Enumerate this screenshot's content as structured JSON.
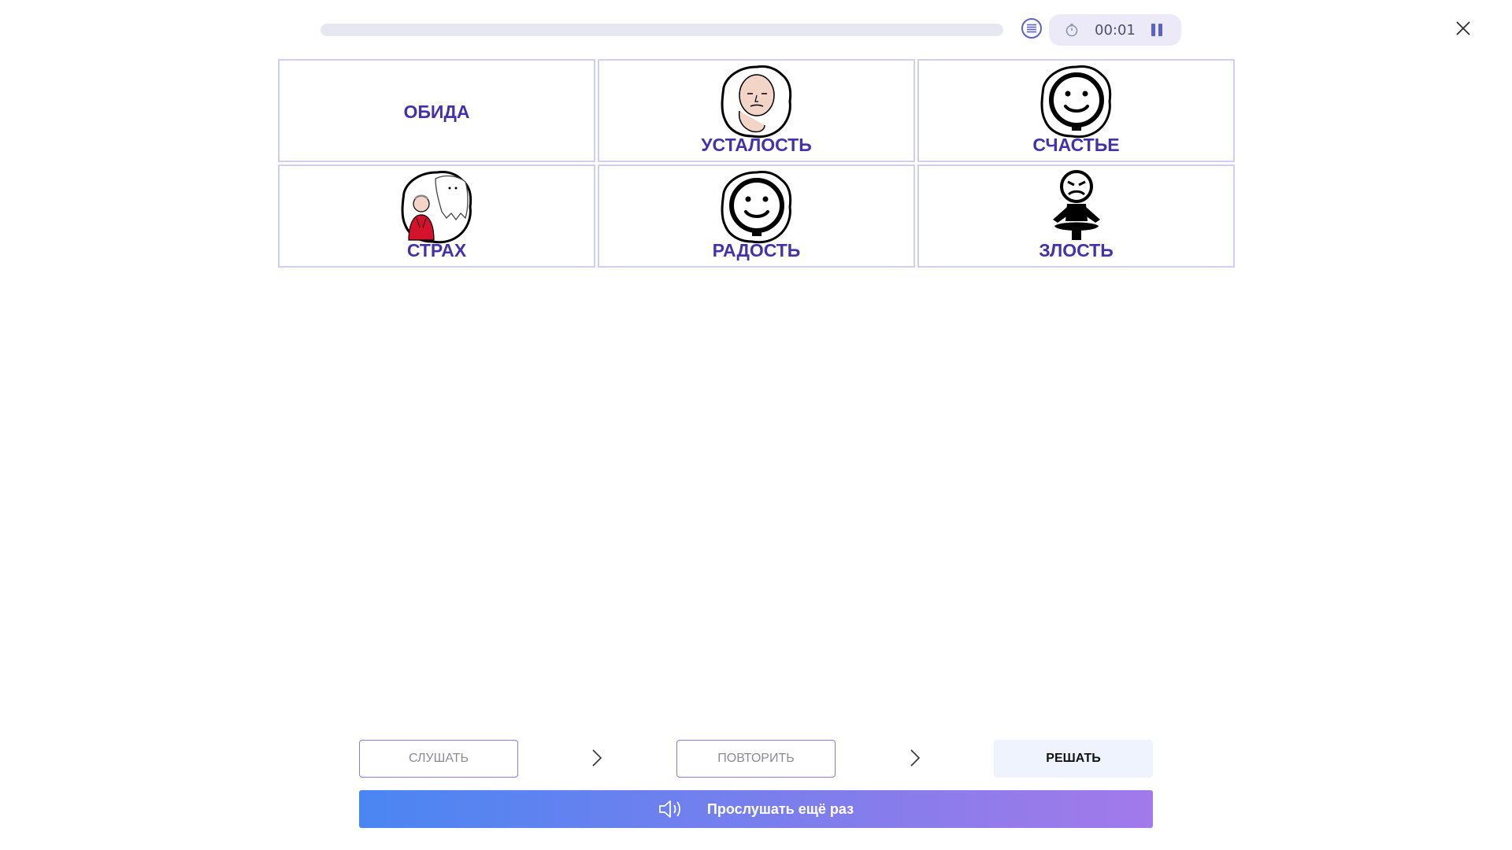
{
  "header": {
    "progress_fraction": 0,
    "timer": "00:01",
    "icons": {
      "list": "list-icon",
      "clock": "clock-icon",
      "pause": "pause-icon",
      "close": "close-icon"
    },
    "accent_color": "#4433a8"
  },
  "cards": [
    {
      "label": "ОБИДА",
      "picture": "none"
    },
    {
      "label": "УСТАЛОСТЬ",
      "picture": "tired-face-icon"
    },
    {
      "label": "СЧАСТЬЕ",
      "picture": "smile-face-icon"
    },
    {
      "label": "СТРАХ",
      "picture": "fear-ghost-icon"
    },
    {
      "label": "РАДОСТЬ",
      "picture": "smile-face-icon"
    },
    {
      "label": "ЗЛОСТЬ",
      "picture": "angry-figure-icon"
    }
  ],
  "stages": [
    {
      "label": "СЛУШАТЬ"
    },
    {
      "label": "ПОВТОРИТЬ"
    },
    {
      "label": "РЕШАТЬ"
    }
  ],
  "listen_again": {
    "label": "Прослушать ещё раз",
    "icon": "speaker-icon"
  }
}
